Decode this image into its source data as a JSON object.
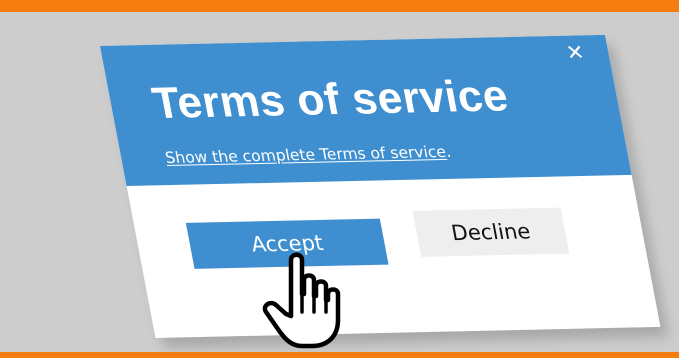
{
  "banner": {
    "top_color": "#f57c0f",
    "background_color": "#cdcdcd"
  },
  "dialog": {
    "close_icon": "close-icon",
    "close_glyph": "✕",
    "title": "Terms of service",
    "subtitle_prefix": "",
    "subtitle_link": "Show the complete Terms of service",
    "subtitle_suffix": ".",
    "accept_label": "Accept",
    "decline_label": "Decline",
    "header_color": "#3f8fd0",
    "accept_color": "#3f8fd0",
    "decline_color": "#eeeeee"
  },
  "pointer": {
    "icon": "hand-pointer-icon"
  }
}
